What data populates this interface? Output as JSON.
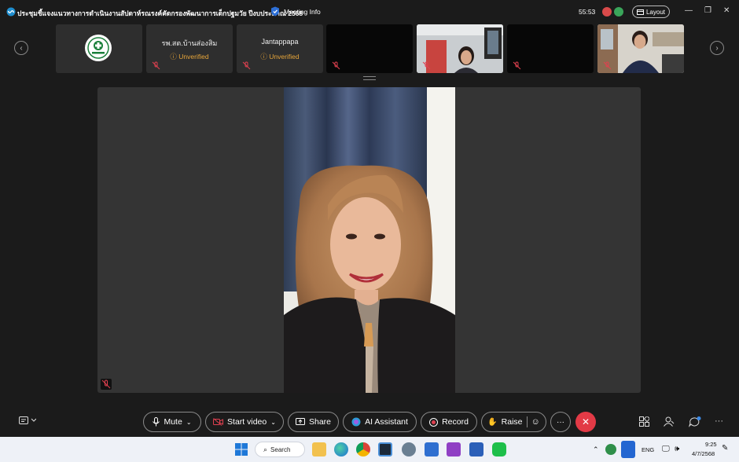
{
  "titlebar": {
    "meeting_title": "ประชุมชี้แจงแนวทางการดำเนินงานสัปดาห์รณรงค์คัดกรองพัฒนาการเด็กปฐมวัย ปีงบประมาณ 2568",
    "meeting_info_label": "Meeting Info",
    "timer": "55:53",
    "layout_label": "Layout"
  },
  "participants": [
    {
      "kind": "logo",
      "name": "",
      "status": ""
    },
    {
      "kind": "name",
      "name": "รพ.สต.บ้านส่องสิม",
      "status": "Unverified"
    },
    {
      "kind": "name",
      "name": "Jantappapa",
      "status": "Unverified"
    },
    {
      "kind": "black",
      "name": "",
      "status": ""
    },
    {
      "kind": "video",
      "name": "",
      "status": ""
    },
    {
      "kind": "black",
      "name": "",
      "status": ""
    },
    {
      "kind": "video",
      "name": "",
      "status": ""
    }
  ],
  "controls": {
    "mute_label": "Mute",
    "video_label": "Start video",
    "share_label": "Share",
    "ai_label": "AI Assistant",
    "record_label": "Record",
    "raise_label": "Raise",
    "more_label": "···"
  },
  "taskbar": {
    "search_label": "Search",
    "lang": "ENG",
    "time": "9:25",
    "date": "4/7/2568"
  },
  "colors": {
    "leave": "#e23a46",
    "unverified": "#e6a53a",
    "rec_red": "#d94a4a",
    "rec_green": "#3aa55a"
  }
}
